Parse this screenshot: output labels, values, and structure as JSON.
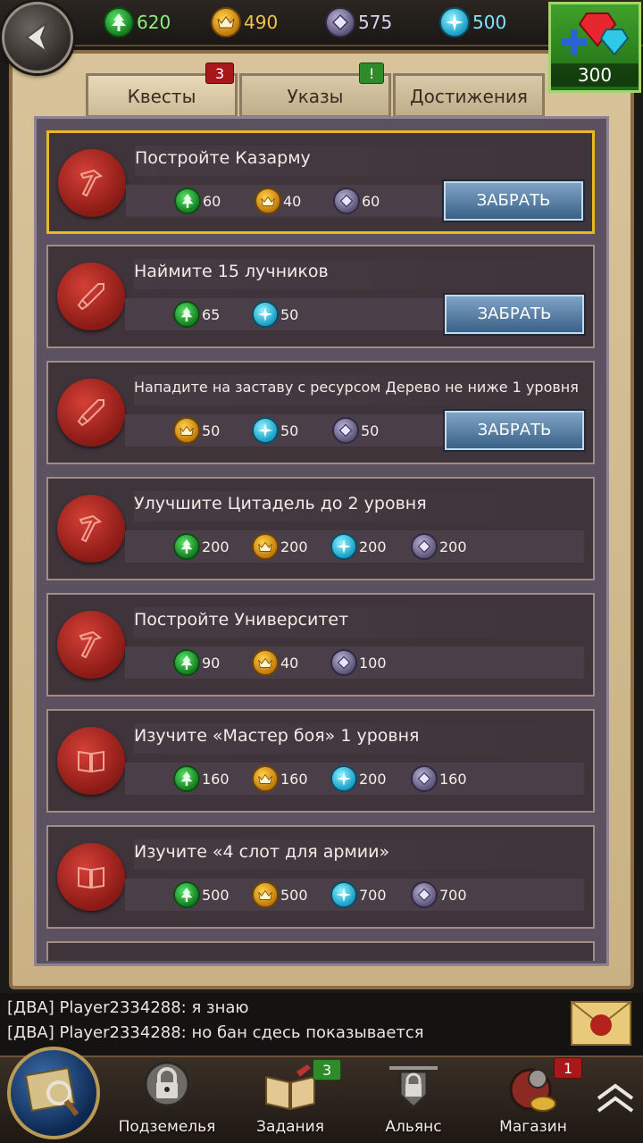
{
  "resources": {
    "wood": "620",
    "gold": "490",
    "stone": "575",
    "mana": "500"
  },
  "gems": {
    "count": "300"
  },
  "tabs": [
    {
      "label": "Квесты",
      "badge": "3"
    },
    {
      "label": "Указы",
      "badge": "!"
    },
    {
      "label": "Достижения"
    }
  ],
  "quests": [
    {
      "title": "Постройте Казарму",
      "icon": "hammer-seal-icon",
      "rewards": [
        {
          "type": "wood",
          "amount": "60"
        },
        {
          "type": "gold",
          "amount": "40"
        },
        {
          "type": "stone",
          "amount": "60"
        }
      ],
      "button": "ЗАБРАТЬ"
    },
    {
      "title": "Наймите 15 лучников",
      "icon": "sword-seal-icon",
      "rewards": [
        {
          "type": "wood",
          "amount": "65"
        },
        {
          "type": "mana",
          "amount": "50"
        }
      ],
      "button": "ЗАБРАТЬ"
    },
    {
      "title": "Нападите на заставу с ресурсом Дерево не ниже 1 уровня",
      "icon": "sword-seal-icon",
      "rewards": [
        {
          "type": "gold",
          "amount": "50"
        },
        {
          "type": "mana",
          "amount": "50"
        },
        {
          "type": "stone",
          "amount": "50"
        }
      ],
      "button": "ЗАБРАТЬ"
    },
    {
      "title": "Улучшите Цитадель до 2 уровня",
      "icon": "hammer-seal-icon",
      "rewards": [
        {
          "type": "wood",
          "amount": "200"
        },
        {
          "type": "gold",
          "amount": "200"
        },
        {
          "type": "mana",
          "amount": "200"
        },
        {
          "type": "stone",
          "amount": "200"
        }
      ]
    },
    {
      "title": "Постройте Университет",
      "icon": "hammer-seal-icon",
      "rewards": [
        {
          "type": "wood",
          "amount": "90"
        },
        {
          "type": "gold",
          "amount": "40"
        },
        {
          "type": "stone",
          "amount": "100"
        }
      ]
    },
    {
      "title": "Изучите «Мастер боя» 1 уровня",
      "icon": "book-seal-icon",
      "rewards": [
        {
          "type": "wood",
          "amount": "160"
        },
        {
          "type": "gold",
          "amount": "160"
        },
        {
          "type": "mana",
          "amount": "200"
        },
        {
          "type": "stone",
          "amount": "160"
        }
      ]
    },
    {
      "title": "Изучите «4 слот для армии»",
      "icon": "book-seal-icon",
      "rewards": [
        {
          "type": "wood",
          "amount": "500"
        },
        {
          "type": "gold",
          "amount": "500"
        },
        {
          "type": "mana",
          "amount": "700"
        },
        {
          "type": "stone",
          "amount": "700"
        }
      ]
    }
  ],
  "chat": [
    "[ДВА] Player2334288: я знаю",
    "[ДВА] Player2334288: но бан сдесь показывается"
  ],
  "nav": [
    {
      "label": "Подземелья"
    },
    {
      "label": "Задания",
      "badge": "3"
    },
    {
      "label": "Альянс"
    },
    {
      "label": "Магазин",
      "badge": "1"
    }
  ],
  "colors": {
    "wood": "#1f9a2c",
    "gold": "#d7960f",
    "stone": "#7a729a",
    "mana": "#2cb6e0",
    "highlight": "#e7b820"
  }
}
